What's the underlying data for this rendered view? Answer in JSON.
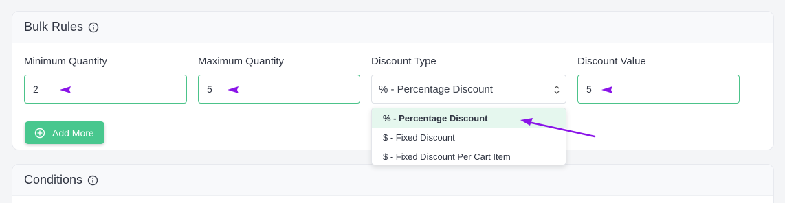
{
  "bulk_rules": {
    "title": "Bulk Rules",
    "fields": {
      "min_qty": {
        "label": "Minimum Quantity",
        "value": "2"
      },
      "max_qty": {
        "label": "Maximum Quantity",
        "value": "5"
      },
      "discount_type": {
        "label": "Discount Type",
        "value": "% - Percentage Discount"
      },
      "discount_value": {
        "label": "Discount Value",
        "value": "5"
      }
    },
    "add_more_label": "Add More",
    "dropdown_options": [
      "% - Percentage Discount",
      "$ - Fixed Discount",
      "$ - Fixed Discount Per Cart Item"
    ]
  },
  "conditions": {
    "title": "Conditions"
  },
  "colors": {
    "accent_green": "#48c78e",
    "input_border_green": "#4cc38a",
    "annotation_purple": "#8a14e8",
    "selected_option_bg": "#e5f7ee"
  },
  "icons": {
    "info": "info-circle-icon",
    "plus": "plus-circle-icon",
    "chevron": "chevron-up-down-icon",
    "annotation": "purple-pointer-arrow"
  }
}
